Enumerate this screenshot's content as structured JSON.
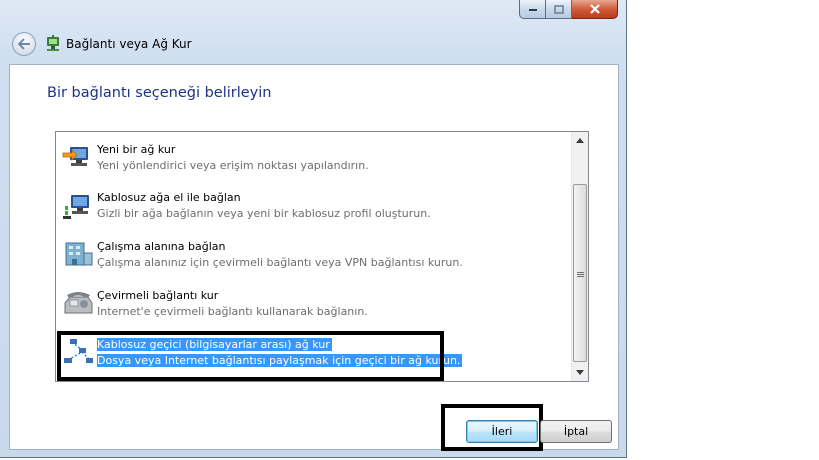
{
  "window": {
    "title": "Bağlantı veya Ağ Kur",
    "controls": {
      "minimize_icon": "minimize-icon",
      "maximize_icon": "maximize-icon",
      "close_icon": "close-icon"
    }
  },
  "page": {
    "heading": "Bir bağlantı seçeneği belirleyin"
  },
  "options": [
    {
      "title": "Yeni bir ağ kur",
      "description": "Yeni yönlendirici veya erişim noktası yapılandırın.",
      "icon": "network-setup-icon",
      "selected": false
    },
    {
      "title": "Kablosuz ağa el ile bağlan",
      "description": "Gizli bir ağa bağlanın veya yeni bir kablosuz profil oluşturun.",
      "icon": "wireless-network-icon",
      "selected": false
    },
    {
      "title": "Çalışma alanına bağlan",
      "description": "Çalışma alanınız için çevirmeli bağlantı veya VPN bağlantısı kurun.",
      "icon": "workplace-vpn-icon",
      "selected": false
    },
    {
      "title": "Çevirmeli bağlantı kur",
      "description": "Internet'e çevirmeli bağlantı kullanarak bağlanın.",
      "icon": "dialup-phone-icon",
      "selected": false
    },
    {
      "title": "Kablosuz geçici (bilgisayarlar arası) ağ kur",
      "description": "Dosya veya Internet bağlantısı paylaşmak için geçici bir ağ kurun.",
      "icon": "adhoc-network-icon",
      "selected": true
    }
  ],
  "buttons": {
    "next": "İleri",
    "cancel": "İptal"
  },
  "colors": {
    "heading": "#1e3287",
    "selection": "#3399ff",
    "annotation_box": "#000000"
  }
}
